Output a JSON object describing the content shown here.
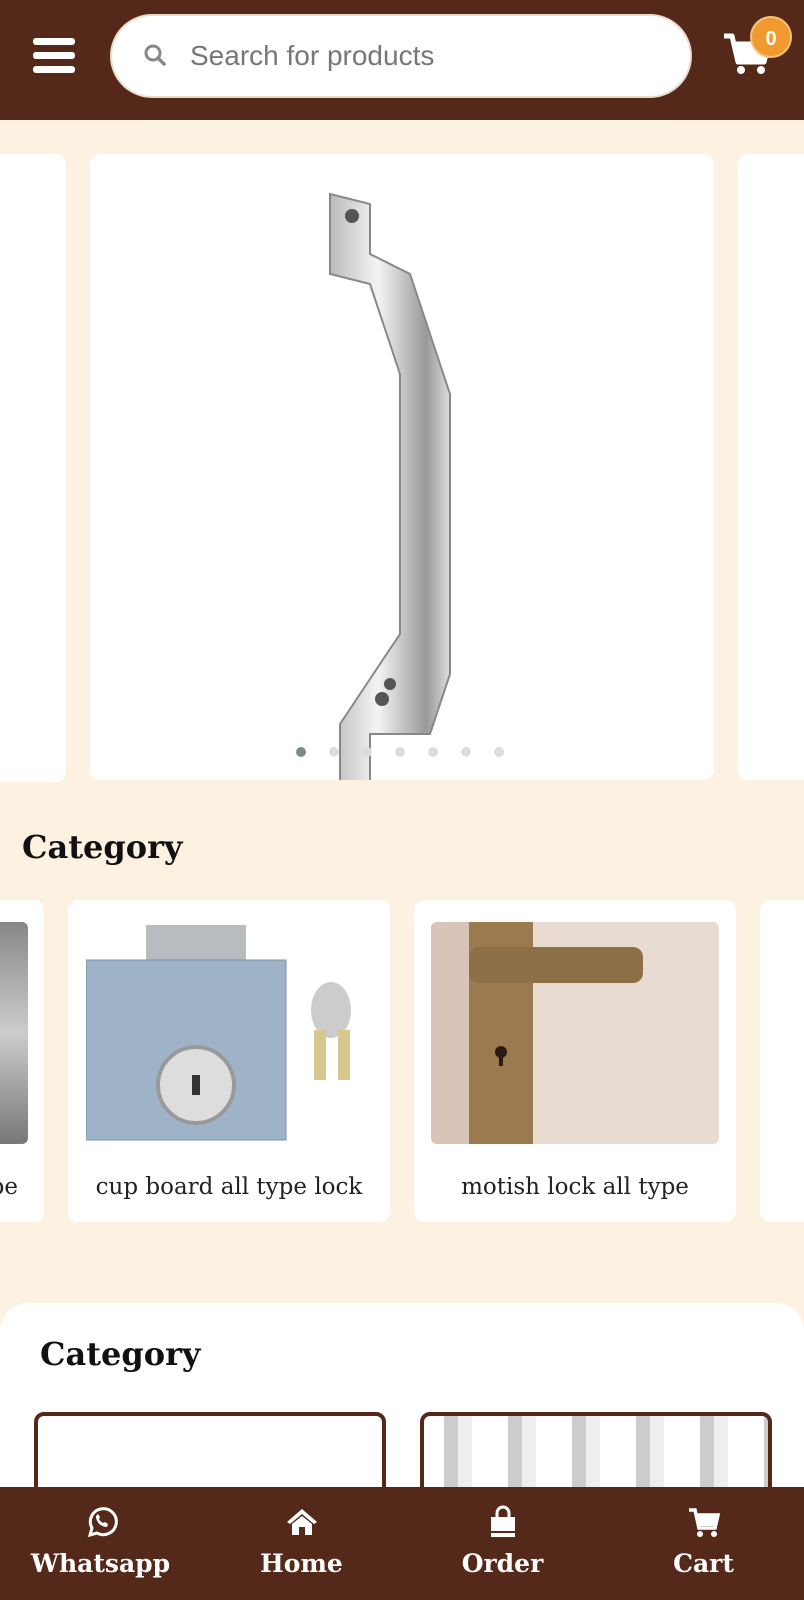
{
  "header": {
    "search_placeholder": "Search for products",
    "cart_count": "0"
  },
  "carousel": {
    "slides": 7,
    "active": 0
  },
  "categories": {
    "title": "Category",
    "items": [
      {
        "label": "pe"
      },
      {
        "label": "cup board all type lock"
      },
      {
        "label": "motish lock all type"
      }
    ]
  },
  "section2": {
    "title": "Category"
  },
  "nav": {
    "items": [
      {
        "label": "Whatsapp",
        "icon": "whatsapp-icon"
      },
      {
        "label": "Home",
        "icon": "home-icon"
      },
      {
        "label": "Order",
        "icon": "shopping-bag-icon"
      },
      {
        "label": "Cart",
        "icon": "cart-icon"
      }
    ]
  },
  "colors": {
    "brand": "#55291a",
    "background": "#fdf1e2",
    "badge": "#f09a30"
  }
}
